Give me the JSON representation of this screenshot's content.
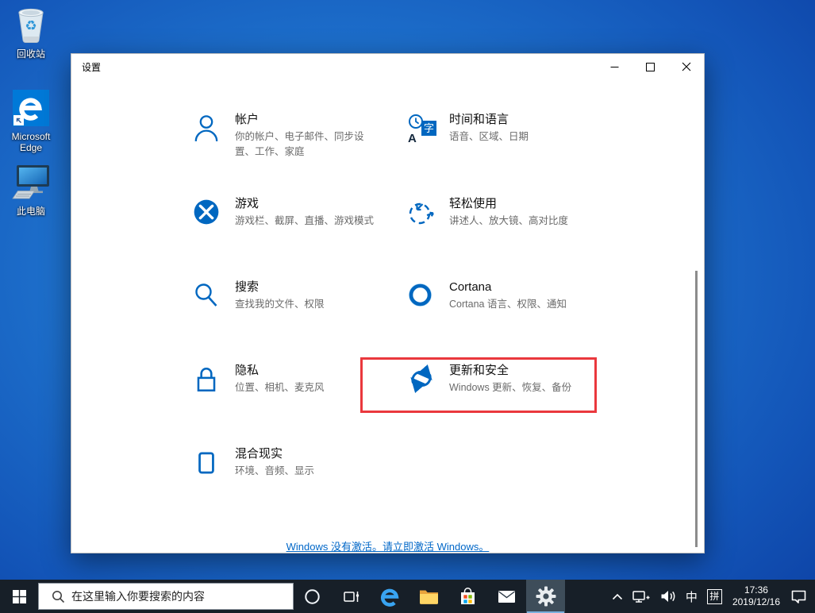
{
  "desktop": {
    "icons": [
      {
        "name": "recycle-bin",
        "label": "回收站"
      },
      {
        "name": "microsoft-edge",
        "label": "Microsoft Edge"
      },
      {
        "name": "this-pc",
        "label": "此电脑"
      }
    ]
  },
  "window": {
    "title": "设置",
    "tiles": [
      {
        "title": "帐户",
        "subtitle": "你的帐户、电子邮件、同步设置、工作、家庭",
        "icon": "person-icon"
      },
      {
        "title": "时间和语言",
        "subtitle": "语音、区域、日期",
        "icon": "time-language-icon"
      },
      {
        "title": "游戏",
        "subtitle": "游戏栏、截屏、直播、游戏模式",
        "icon": "xbox-icon"
      },
      {
        "title": "轻松使用",
        "subtitle": "讲述人、放大镜、高对比度",
        "icon": "ease-of-access-icon"
      },
      {
        "title": "搜索",
        "subtitle": "查找我的文件、权限",
        "icon": "search-icon"
      },
      {
        "title": "Cortana",
        "subtitle": "Cortana 语言、权限、通知",
        "icon": "cortana-ring-icon"
      },
      {
        "title": "隐私",
        "subtitle": "位置、相机、麦克风",
        "icon": "lock-icon"
      },
      {
        "title": "更新和安全",
        "subtitle": "Windows 更新、恢复、备份",
        "icon": "sync-icon",
        "highlighted": true
      },
      {
        "title": "混合现实",
        "subtitle": "环境、音频、显示",
        "icon": "headset-icon"
      }
    ],
    "icon_glyphs": {
      "a": "A",
      "zi": "字"
    },
    "activation_notice": "Windows 没有激活。请立即激活 Windows。"
  },
  "taskbar": {
    "search_placeholder": "在这里输入你要搜索的内容",
    "tray": {
      "ime_lang": "中",
      "ime_mode": "拼",
      "time": "17:36",
      "date": "2019/12/16"
    }
  },
  "colors": {
    "accent": "#0067c0",
    "highlight_red": "#ea383d",
    "link": "#0067c8",
    "taskbar_bg": "#171f28"
  }
}
